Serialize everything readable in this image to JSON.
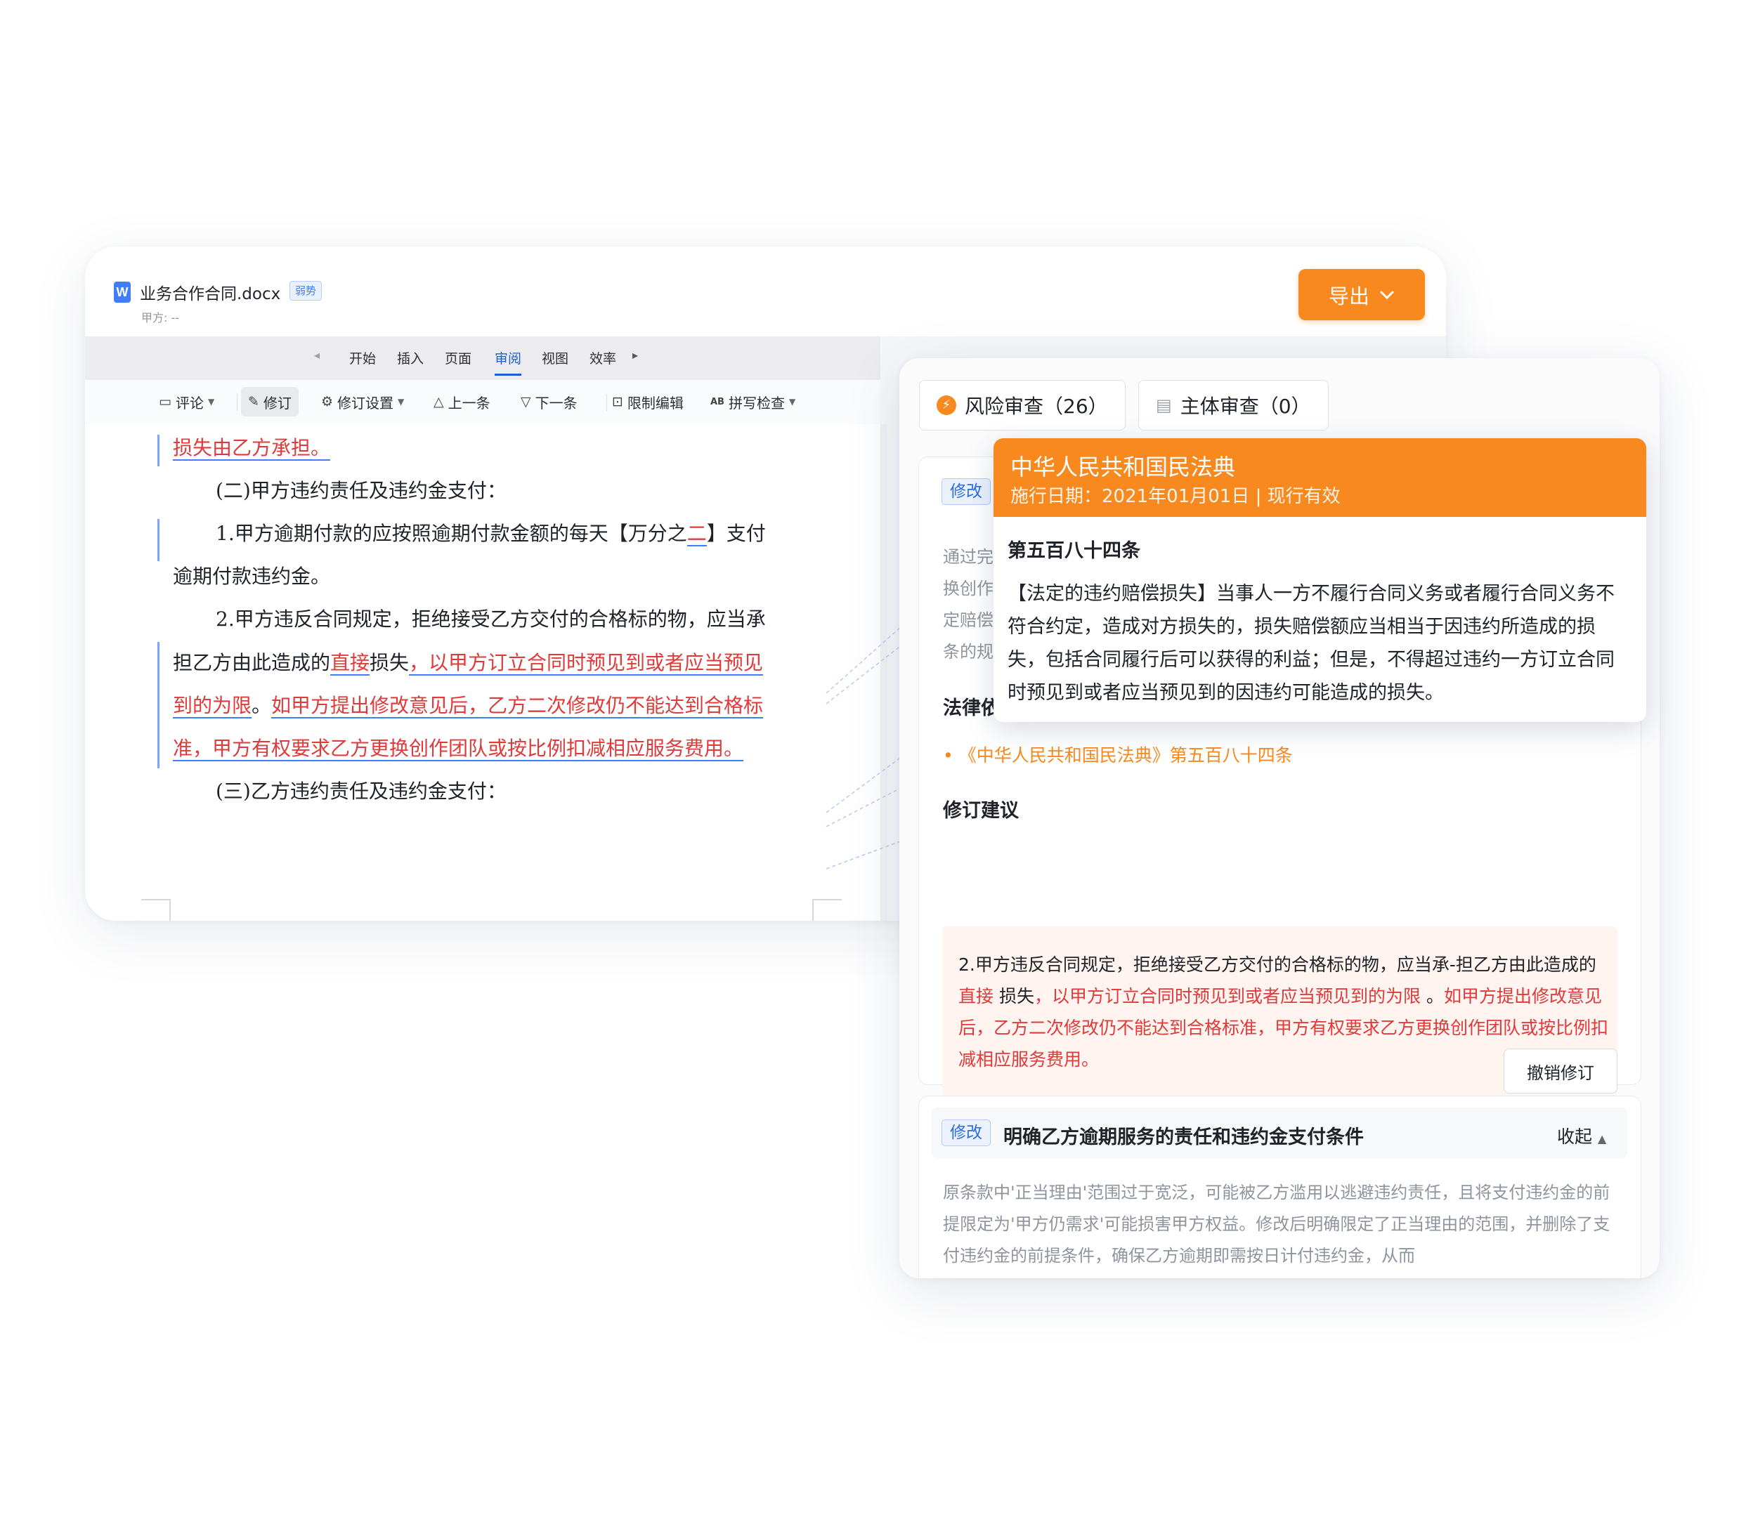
{
  "document": {
    "filename": "业务合作合同.docx",
    "badge": "弱势",
    "party": "甲方: --",
    "export_label": "导出",
    "ribbon_tabs": [
      "开始",
      "插入",
      "页面",
      "审阅",
      "视图",
      "效率"
    ],
    "active_tab": "审阅",
    "tools": {
      "comment": "评论",
      "revise": "修订",
      "revise_settings": "修订设置",
      "prev": "上一条",
      "next": "下一条",
      "restrict": "限制编辑",
      "spell": "拼写检查",
      "spell_icon_text": "AB"
    },
    "lines": {
      "l1": "损失由乙方承担。",
      "l2": "(二)甲方违约责任及违约金支付：",
      "l3a": "1.甲方逾期付款的应按照逾期付款金额的每天【万分之",
      "l3b": "二",
      "l3c": "】支付",
      "l4": "逾期付款违约金。",
      "l5": "2.甲方违反合同规定，拒绝接受乙方交付的合格标的物，应当承",
      "l6a": "担乙方由此造成的",
      "l6b": "直接",
      "l6c": "损失",
      "l6d": "，以甲方订立合同时预见到或者应当预见",
      "l7a": "到的为限",
      "l7b": "。",
      "l7c": "如甲方提出修改意见后，乙方二次修改仍不能达到合格标",
      "l8": "准，甲方有权要求乙方更换创作团队或按比例扣减相应服务费用。",
      "l9": "(三)乙方违约责任及违约金支付："
    }
  },
  "review": {
    "tab_risk": "风险审查（26）",
    "tab_subject": "主体审查（0）",
    "card1": {
      "tag": "修改",
      "body_fragments": [
        "通过完",
        "换创作",
        "定赔偿",
        "条的规"
      ],
      "law_basis_title_fragment": "法律依",
      "law_ref": "《中华人民共和国民法典》第五百八十四条",
      "suggest_title": "修订建议",
      "suggest_text": {
        "p1": "2.甲方违反合同规定，拒绝接受乙方交付的合格标的物，应当承-担乙方由此造成的 ",
        "p2_red": "直接",
        "p3": " 损失",
        "p4_red": "，以甲方订立合同时预见到或者应当预见到的为限",
        "p5": " 。",
        "p6_red": "如甲方提出修改意见后，乙方二次修改仍不能达到合格标准，甲方有权要求乙方更换创作团队或按比例扣减相应服务费用。"
      },
      "undo": "撤销修订"
    },
    "card2": {
      "tag": "修改",
      "title": "明确乙方逾期服务的责任和违约金支付条件",
      "collapse": "收起",
      "body": "原条款中'正当理由'范围过于宽泛，可能被乙方滥用以逃避违约责任，且将支付违约金的前提限定为'甲方仍需求'可能损害甲方权益。修改后明确限定了正当理由的范围，并删除了支付违约金的前提条件，确保乙方逾期即需按日计付违约金，从而"
    }
  },
  "law_popup": {
    "title": "中华人民共和国民法典",
    "date": "施行日期：2021年01月01日 | 现行有效",
    "article": "第五百八十四条",
    "body": "【法定的违约赔偿损失】当事人一方不履行合同义务或者履行合同义务不符合约定，造成对方损失的，损失赔偿额应当相当于因违约所造成的损失，包括合同履行后可以获得的利益；但是，不得超过违约一方订立合同时预见到或者应当预见到的因违约可能造成的损失。"
  },
  "colors": {
    "accent_orange": "#f7891e",
    "revision_red": "#e03a3a",
    "link_blue": "#3f7dfb"
  }
}
